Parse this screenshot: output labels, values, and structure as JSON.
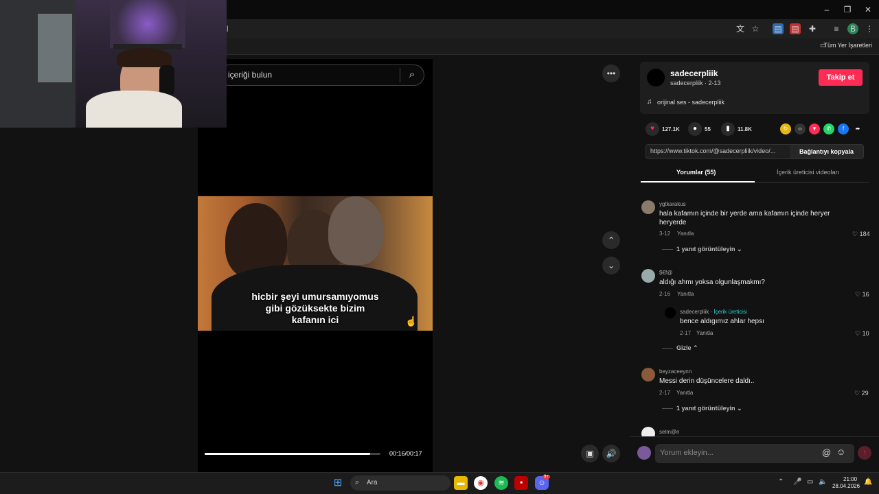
{
  "browser": {
    "url_fragment": "l",
    "bookmarks_label": "Tüm Yer İşaretleri",
    "profile_letter": "B"
  },
  "tiktok": {
    "search_placeholder": "içeriği bulun",
    "caption_lines": [
      "hicbir şeyi umursamıyomus",
      "gibi gözüksekte bizim",
      "kafanın ici"
    ],
    "time": "00:16/00:17",
    "progress": 0.94
  },
  "profile": {
    "username": "sadecerpliik",
    "handle": "sadecerpliik · 2-13",
    "follow": "Takip et",
    "music": "orijinal ses - sadecerpliik",
    "likes": "127.1K",
    "comments": "55",
    "saves": "11.8K",
    "link": "https://www.tiktok.com/@sadecerpliik/video/...",
    "copy": "Bağlantıyı kopyala"
  },
  "tabs": {
    "comments": "Yorumlar (55)",
    "creator_videos": "İçerik üreticisi videoları"
  },
  "comments": [
    {
      "user": "ygtkarakus",
      "text1": "hala kafamın içinde bir yerde ama kafamın içinde heryer",
      "text2": "heryerde",
      "date": "3-12",
      "reply": "Yanıtla",
      "likes": "184",
      "more": "1 yanıt görüntüleyin"
    },
    {
      "user": "$€f@",
      "text1": "aldığı ahmı yoksa olgunlaşmakmı?",
      "date": "2-16",
      "reply": "Yanıtla",
      "likes": "16"
    },
    {
      "user": "sadecerpliik",
      "tag": "İçerik üreticisi",
      "text1": "bence aldıgımız ahlar hepsı",
      "date": "2-17",
      "reply": "Yanıtla",
      "likes": "10",
      "hide": "Gizle"
    },
    {
      "user": "beyzaceeynn",
      "text1": "Messi derin düşüncelere daldı..",
      "date": "2-17",
      "reply": "Yanıtla",
      "likes": "29",
      "more": "1 yanıt görüntüleyin"
    },
    {
      "user": "selm@n"
    }
  ],
  "comment_input": {
    "placeholder": "Yorum ekleyin..."
  },
  "taskbar": {
    "search": "Ara",
    "time": "21:00",
    "date": "28.04.2026",
    "discord_badge": "9+"
  },
  "colors": {
    "accent": "#fe2c55",
    "creator": "#2bd0d6"
  }
}
